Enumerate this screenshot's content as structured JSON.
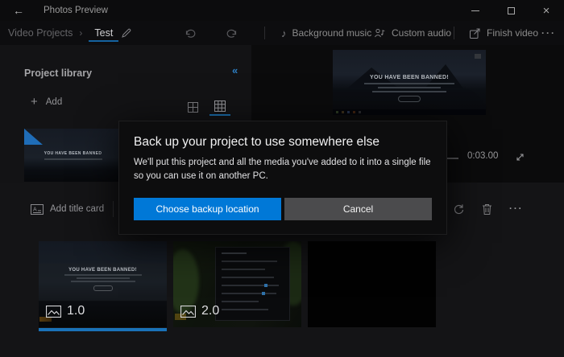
{
  "window": {
    "title": "Photos Preview"
  },
  "icons": {
    "back": "←",
    "close": "×",
    "breadcrumb_chevron": "›",
    "collapse_chevron": "«",
    "plus": "+",
    "music_note": "♪",
    "more_dots": "···"
  },
  "toolbar": {
    "breadcrumb_root": "Video Projects",
    "project_name": "Test",
    "background_music_label": "Background music",
    "custom_audio_label": "Custom audio",
    "finish_video_label": "Finish video"
  },
  "library": {
    "heading": "Project library",
    "add_label": "Add",
    "thumb_banner": "YOU HAVE BEEN BANNED"
  },
  "preview": {
    "banner_title": "YOU HAVE BEEN BANNED!",
    "time": "0:03.00"
  },
  "timeline": {
    "add_title_card_label": "Add title card",
    "clips": [
      {
        "label": "1.0",
        "banner": "YOU HAVE BEEN BANNED!"
      },
      {
        "label": "2.0"
      },
      {
        "label": ""
      }
    ]
  },
  "dialog": {
    "title": "Back up your project to use somewhere else",
    "body": "We'll put this project and all the media you've added to it into a single file so you can use it on another PC.",
    "primary_label": "Choose backup location",
    "cancel_label": "Cancel"
  },
  "colors": {
    "accent": "#0078d7"
  }
}
